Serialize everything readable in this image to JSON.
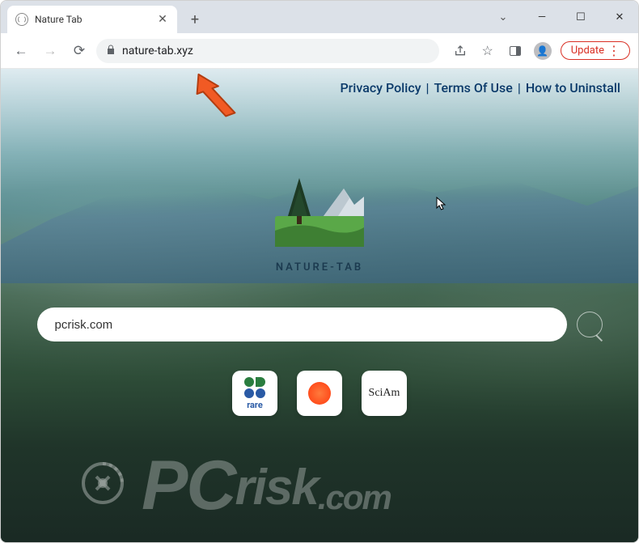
{
  "browser": {
    "tab_title": "Nature Tab",
    "url": "nature-tab.xyz",
    "update_label": "Update"
  },
  "top_links": {
    "privacy": "Privacy Policy",
    "terms": "Terms Of Use",
    "uninstall": "How to Uninstall"
  },
  "logo": {
    "text": "NATURE-TAB"
  },
  "search": {
    "value": "pcrisk.com"
  },
  "shortcuts": {
    "rare": "rare",
    "sciam": "SciAm"
  },
  "watermark": {
    "text": "PCrisk.com"
  }
}
